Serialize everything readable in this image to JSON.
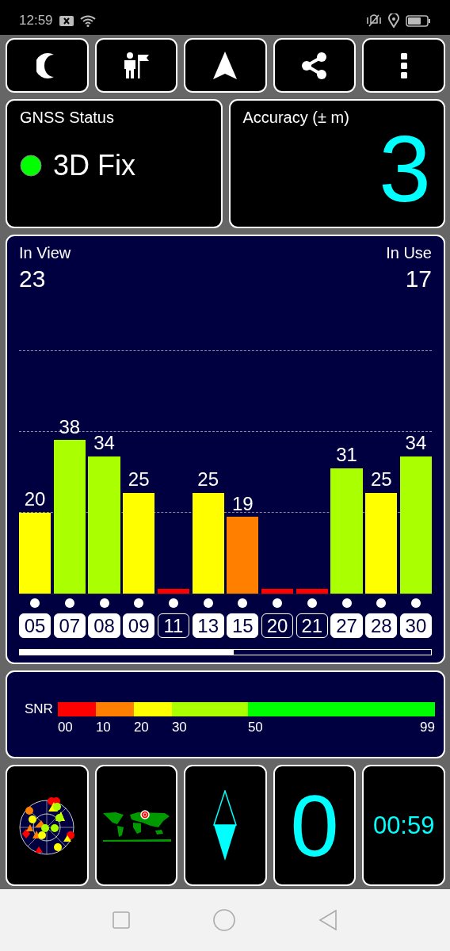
{
  "status_bar": {
    "time": "12:59"
  },
  "gnss_status": {
    "title": "GNSS Status",
    "fix": "3D Fix"
  },
  "accuracy": {
    "title": "Accuracy (± m)",
    "value": "3"
  },
  "satellites_panel": {
    "in_view_label": "In View",
    "in_view": "23",
    "in_use_label": "In Use",
    "in_use": "17",
    "satellites": [
      {
        "id": "05",
        "snr": "20",
        "color": "#ffff00",
        "in_use": true
      },
      {
        "id": "07",
        "snr": "38",
        "color": "#aaff00",
        "in_use": true
      },
      {
        "id": "08",
        "snr": "34",
        "color": "#aaff00",
        "in_use": true
      },
      {
        "id": "09",
        "snr": "25",
        "color": "#ffff00",
        "in_use": true
      },
      {
        "id": "11",
        "color": "#ff0000",
        "in_use": false
      },
      {
        "id": "13",
        "snr": "25",
        "color": "#ffff00",
        "in_use": true
      },
      {
        "id": "15",
        "snr": "19",
        "color": "#ff8000",
        "in_use": true
      },
      {
        "id": "20",
        "color": "#ff0000",
        "in_use": false
      },
      {
        "id": "21",
        "color": "#ff0000",
        "in_use": false
      },
      {
        "id": "27",
        "snr": "31",
        "color": "#aaff00",
        "in_use": true
      },
      {
        "id": "28",
        "snr": "25",
        "color": "#ffff00",
        "in_use": true
      },
      {
        "id": "30",
        "snr": "34",
        "color": "#aaff00",
        "in_use": true
      }
    ]
  },
  "snr_legend": {
    "label": "SNR",
    "ticks": [
      "00",
      "10",
      "20",
      "30",
      "50",
      "99"
    ]
  },
  "tiles": {
    "speed": "0",
    "elapsed": "00:59"
  }
}
